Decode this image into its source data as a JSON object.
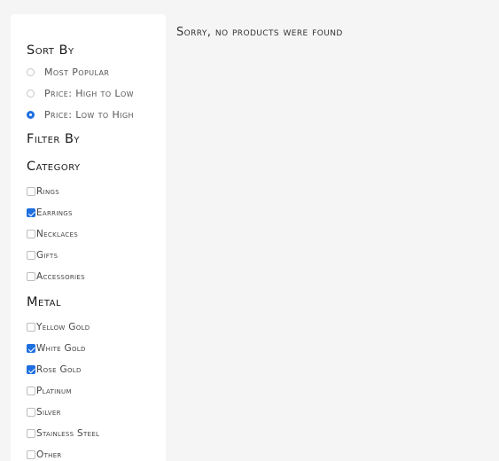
{
  "sort": {
    "heading": "Sort By",
    "options": [
      {
        "label": "Most Popular",
        "selected": false
      },
      {
        "label": "Price: High to Low",
        "selected": false
      },
      {
        "label": "Price: Low to High",
        "selected": true
      }
    ]
  },
  "filter": {
    "heading": "Filter By"
  },
  "category": {
    "heading": "Category",
    "options": [
      {
        "label": "Rings",
        "checked": false
      },
      {
        "label": "Earrings",
        "checked": true
      },
      {
        "label": "Necklaces",
        "checked": false
      },
      {
        "label": "Gifts",
        "checked": false
      },
      {
        "label": "Accessories",
        "checked": false
      }
    ]
  },
  "metal": {
    "heading": "Metal",
    "options": [
      {
        "label": "Yellow Gold",
        "checked": false
      },
      {
        "label": "White Gold",
        "checked": true
      },
      {
        "label": "Rose Gold",
        "checked": true
      },
      {
        "label": "Platinum",
        "checked": false
      },
      {
        "label": "Silver",
        "checked": false
      },
      {
        "label": "Stainless Steel",
        "checked": false
      },
      {
        "label": "Other",
        "checked": false
      }
    ]
  },
  "main": {
    "message": "Sorry, no products were found"
  },
  "colors": {
    "accent": "#1e6fe0",
    "background": "#f5f5f5",
    "panel": "#ffffff"
  }
}
